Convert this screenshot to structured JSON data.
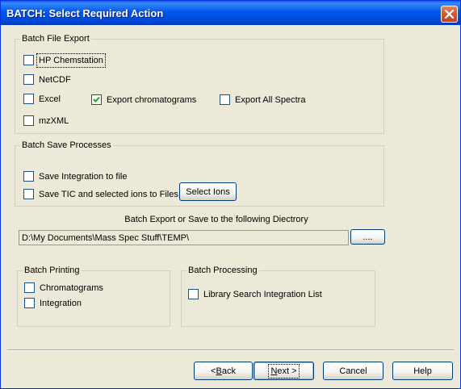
{
  "window": {
    "title": "BATCH: Select Required Action"
  },
  "batch_file_export": {
    "legend": "Batch File Export",
    "hp_chemstation": {
      "label": "HP Chemstation",
      "checked": false
    },
    "netcdf": {
      "label": "NetCDF",
      "checked": false
    },
    "excel": {
      "label": "Excel",
      "checked": false
    },
    "export_chromatograms": {
      "label": "Export chromatograms",
      "checked": true
    },
    "export_all_spectra": {
      "label": "Export All Spectra",
      "checked": false
    },
    "mzxml": {
      "label": "mzXML",
      "checked": false
    }
  },
  "batch_save_processes": {
    "legend": "Batch Save Processes",
    "save_integration": {
      "label": "Save Integration to file",
      "checked": false
    },
    "save_tic": {
      "label": "Save TIC and selected ions to Files",
      "checked": false
    },
    "select_ions_button": "Select Ions"
  },
  "directory": {
    "label": "Batch Export or Save to the following Diectrory",
    "value": "D:\\My Documents\\Mass Spec Stuff\\TEMP\\",
    "browse_button": "...."
  },
  "batch_printing": {
    "legend": "Batch Printing",
    "chromatograms": {
      "label": "Chromatograms",
      "checked": false
    },
    "integration": {
      "label": "Integration",
      "checked": false
    }
  },
  "batch_processing": {
    "legend": "Batch Processing",
    "library_search": {
      "label": "Library Search Integration List",
      "checked": false
    }
  },
  "buttons": {
    "back_prefix": "< ",
    "back_key": "B",
    "back_rest": "ack",
    "next_key": "N",
    "next_rest": "ext >",
    "cancel": "Cancel",
    "help": "Help"
  }
}
